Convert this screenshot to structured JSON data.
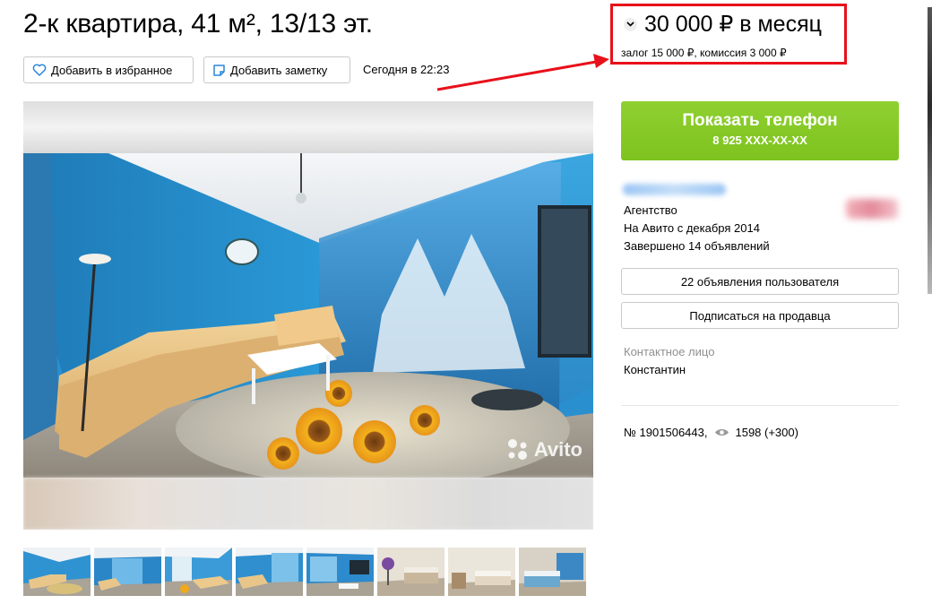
{
  "listing": {
    "title": "2-к квартира, 41 м², 13/13 эт.",
    "favorite_label": "Добавить в избранное",
    "note_label": "Добавить заметку",
    "posted": "Сегодня в 22:23"
  },
  "price": {
    "main": "30 000 ₽ в месяц",
    "details": "залог 15 000 ₽, комиссия 3 000 ₽"
  },
  "photo": {
    "watermark": "Avito",
    "thumbnail_count": 8
  },
  "contact": {
    "phone_button_label": "Показать телефон",
    "phone_number": "8 925 XXX-XX-XX"
  },
  "seller": {
    "type": "Агентство",
    "since": "На Авито с декабря 2014",
    "completed": "Завершено 14 объявлений",
    "ads_button": "22 объявления пользователя",
    "subscribe_button": "Подписаться на продавца",
    "contact_label": "Контактное лицо",
    "contact_name": "Константин"
  },
  "meta": {
    "ad_number": "№ 1901506443,",
    "views": "1598 (+300)"
  },
  "colors": {
    "highlight_red": "#e8101a",
    "phone_green": "#7ec31f",
    "muted_grey": "#909090"
  }
}
